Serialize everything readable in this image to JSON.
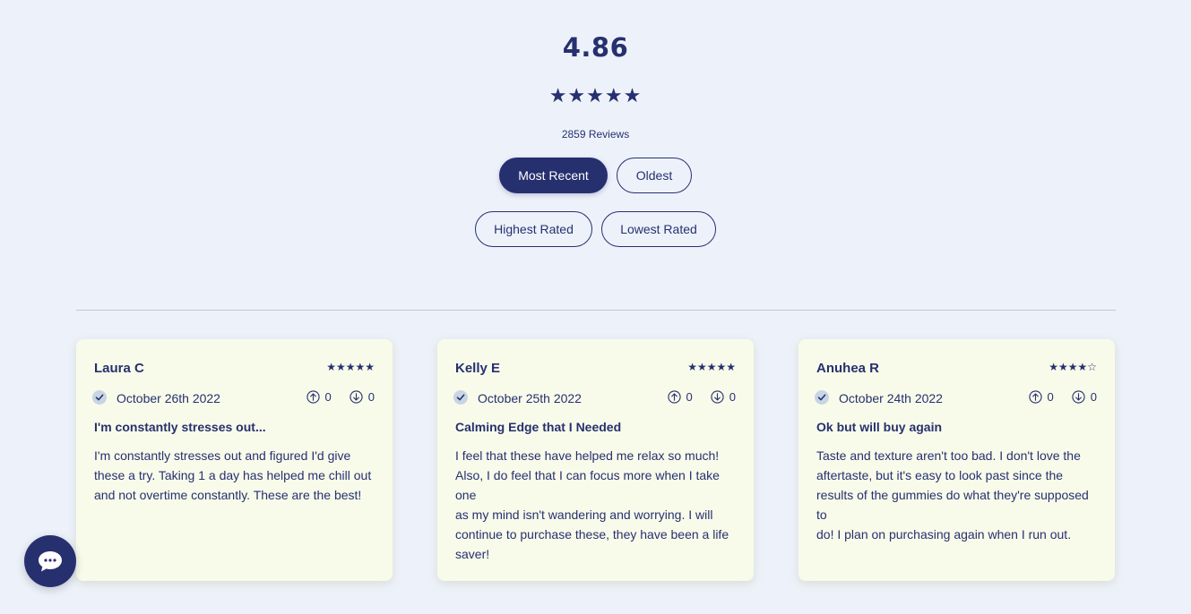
{
  "summary": {
    "average": "4.86",
    "stars": "★★★★★",
    "count": "2859 Reviews"
  },
  "sort": {
    "most_recent": "Most Recent",
    "oldest": "Oldest",
    "highest_rated": "Highest Rated",
    "lowest_rated": "Lowest Rated",
    "active": "Most Recent"
  },
  "reviews": [
    {
      "name": "Laura C",
      "rating": 5,
      "stars": "★★★★★",
      "date": "October 26th 2022",
      "upvotes": "0",
      "downvotes": "0",
      "title": "I'm constantly stresses out...",
      "body": [
        "I'm constantly stresses out and figured I'd give these a try. Taking 1 a day has helped me chill out and not overtime constantly. These are the best!"
      ]
    },
    {
      "name": "Kelly E",
      "rating": 5,
      "stars": "★★★★★",
      "date": "October 25th 2022",
      "upvotes": "0",
      "downvotes": "0",
      "title": "Calming Edge that I Needed",
      "body": [
        "I feel that these have helped me relax so much! Also, I do feel that I can focus more when I take one",
        "as my mind isn't wandering and worrying. I will continue to purchase these, they have been a life saver!"
      ]
    },
    {
      "name": "Anuhea R",
      "rating": 4,
      "stars": "★★★★☆",
      "date": "October 24th 2022",
      "upvotes": "0",
      "downvotes": "0",
      "title": "Ok but will buy again",
      "body": [
        "Taste and texture aren't too bad. I don't love the aftertaste, but it's easy to look past since the results of the gummies do what they're supposed to",
        "do! I plan on purchasing again when I run out."
      ]
    }
  ],
  "colors": {
    "accent": "#27306f",
    "background": "#edf2fa",
    "card": "#f8fbea"
  },
  "icons": [
    "star-icon",
    "check-icon",
    "upvote-icon",
    "downvote-icon",
    "chat-icon"
  ]
}
